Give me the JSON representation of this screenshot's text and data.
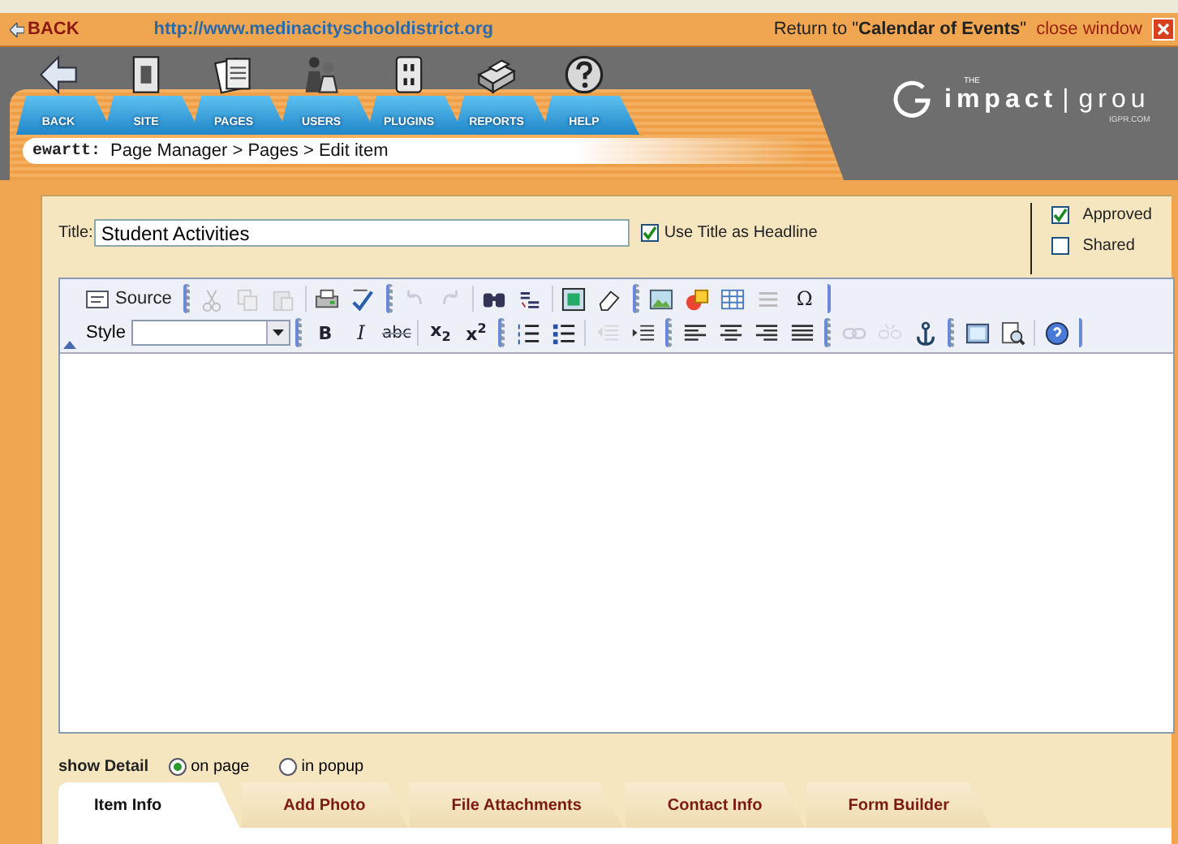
{
  "topbar": {
    "back": "BACK",
    "url": "http://www.medinacityschooldistrict.org",
    "return_prefix": "Return to \"",
    "return_target": "Calendar of Events",
    "return_suffix": "\"",
    "close": "close window"
  },
  "nav": [
    {
      "label": "BACK",
      "kind": "back"
    },
    {
      "label": "SITE",
      "kind": "site"
    },
    {
      "label": "PAGES",
      "kind": "pages"
    },
    {
      "label": "USERS",
      "kind": "users"
    },
    {
      "label": "PLUGINS",
      "kind": "plugins"
    },
    {
      "label": "REPORTS",
      "kind": "reports"
    },
    {
      "label": "HELP",
      "kind": "help"
    }
  ],
  "logo": {
    "small": "THE",
    "name": "impact",
    "sep": "|",
    "name2": "grou",
    "domain": "IGPR.COM"
  },
  "breadcrumb": {
    "user": "ewartt:",
    "path": "Page Manager > Pages > Edit item"
  },
  "form": {
    "title_label": "Title:",
    "title_value": "Student Activities",
    "headline_label": "Use Title as Headline",
    "headline_checked": true,
    "flags": [
      {
        "label": "Approved",
        "checked": true
      },
      {
        "label": "Shared",
        "checked": false
      }
    ]
  },
  "toolbar_rows": [
    [
      {
        "kind": "source",
        "text": "Source",
        "disabled": false
      },
      {
        "kind": "sep"
      },
      {
        "kind": "cut",
        "disabled": true
      },
      {
        "kind": "copy",
        "disabled": true
      },
      {
        "kind": "paste",
        "disabled": true
      },
      {
        "kind": "bar"
      },
      {
        "kind": "print",
        "disabled": false
      },
      {
        "kind": "spell",
        "disabled": false
      },
      {
        "kind": "sep"
      },
      {
        "kind": "undo",
        "disabled": true
      },
      {
        "kind": "redo",
        "disabled": true
      },
      {
        "kind": "bar"
      },
      {
        "kind": "find",
        "disabled": false
      },
      {
        "kind": "replace",
        "disabled": false
      },
      {
        "kind": "bar"
      },
      {
        "kind": "selectall",
        "disabled": false
      },
      {
        "kind": "eraser",
        "disabled": false
      },
      {
        "kind": "sep"
      },
      {
        "kind": "image",
        "disabled": false
      },
      {
        "kind": "flash",
        "disabled": false
      },
      {
        "kind": "table",
        "disabled": false
      },
      {
        "kind": "rule",
        "disabled": false
      },
      {
        "kind": "glyph",
        "text": "Ω",
        "disabled": false
      },
      {
        "kind": "end"
      }
    ],
    [
      {
        "kind": "style",
        "text": "Style"
      },
      {
        "kind": "sep"
      },
      {
        "kind": "bold",
        "text": "B",
        "disabled": false
      },
      {
        "kind": "italic",
        "text": "I",
        "disabled": false
      },
      {
        "kind": "strike",
        "text": "abc",
        "disabled": false
      },
      {
        "kind": "bar"
      },
      {
        "kind": "bold",
        "text": "x$_{2}$",
        "disabled": false
      },
      {
        "kind": "bold",
        "text": "x$^{2}$",
        "disabled": false
      },
      {
        "kind": "sep"
      },
      {
        "kind": "numlist",
        "disabled": false
      },
      {
        "kind": "bullist",
        "disabled": false
      },
      {
        "kind": "bar"
      },
      {
        "kind": "outdent",
        "disabled": true
      },
      {
        "kind": "indent",
        "disabled": false
      },
      {
        "kind": "sep"
      },
      {
        "kind": "alignleft",
        "disabled": false
      },
      {
        "kind": "aligncenter",
        "disabled": false
      },
      {
        "kind": "alignright",
        "disabled": false
      },
      {
        "kind": "justify",
        "disabled": false
      },
      {
        "kind": "sep"
      },
      {
        "kind": "link",
        "disabled": true
      },
      {
        "kind": "unlink",
        "disabled": true
      },
      {
        "kind": "anchor",
        "disabled": false
      },
      {
        "kind": "sep"
      },
      {
        "kind": "blocks",
        "disabled": false
      },
      {
        "kind": "preview",
        "disabled": false
      },
      {
        "kind": "bar"
      },
      {
        "kind": "about",
        "disabled": false
      },
      {
        "kind": "end"
      }
    ]
  ],
  "detail": {
    "label": "show Detail",
    "options": [
      {
        "label": "on page",
        "selected": true
      },
      {
        "label": "in popup",
        "selected": false
      }
    ]
  },
  "tabs": [
    {
      "label": "Item Info",
      "selected": true
    },
    {
      "label": "Add Photo",
      "selected": false
    },
    {
      "label": "File Attachments",
      "selected": false
    },
    {
      "label": "Contact Info",
      "selected": false
    },
    {
      "label": "Form Builder",
      "selected": false
    }
  ]
}
